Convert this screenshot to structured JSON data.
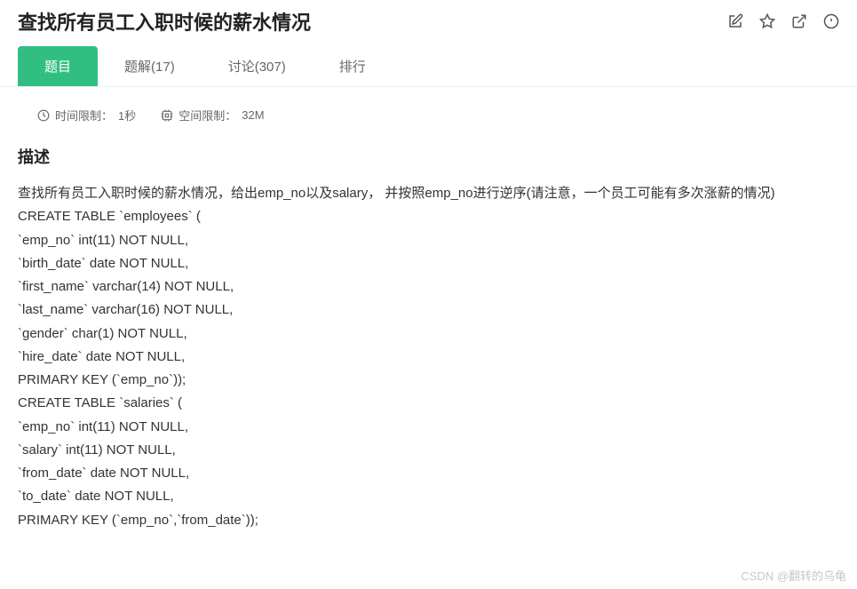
{
  "header": {
    "title": "查找所有员工入职时候的薪水情况",
    "icons": {
      "edit": "edit-icon",
      "star": "star-icon",
      "share": "share-icon",
      "info": "info-icon"
    }
  },
  "tabs": {
    "problem": "题目",
    "solution": "题解(17)",
    "discuss": "讨论(307)",
    "rank": "排行"
  },
  "limits": {
    "time_label": "时间限制：",
    "time_value": "1秒",
    "space_label": "空间限制：",
    "space_value": "32M"
  },
  "section": {
    "title": "描述"
  },
  "description": {
    "intro": "查找所有员工入职时候的薪水情况，给出emp_no以及salary， 并按照emp_no进行逆序(请注意，一个员工可能有多次涨薪的情况)",
    "sql_lines": [
      "CREATE TABLE `employees` (",
      "`emp_no` int(11) NOT NULL,",
      "`birth_date` date NOT NULL,",
      "`first_name` varchar(14) NOT NULL,",
      "`last_name` varchar(16) NOT NULL,",
      "`gender` char(1) NOT NULL,",
      "`hire_date` date NOT NULL,",
      "PRIMARY KEY (`emp_no`));",
      "CREATE TABLE `salaries` (",
      "`emp_no` int(11) NOT NULL,",
      "`salary` int(11) NOT NULL,",
      "`from_date` date NOT NULL,",
      "`to_date` date NOT NULL,",
      "PRIMARY KEY (`emp_no`,`from_date`));"
    ]
  },
  "watermark": "CSDN @翻转的乌龟"
}
